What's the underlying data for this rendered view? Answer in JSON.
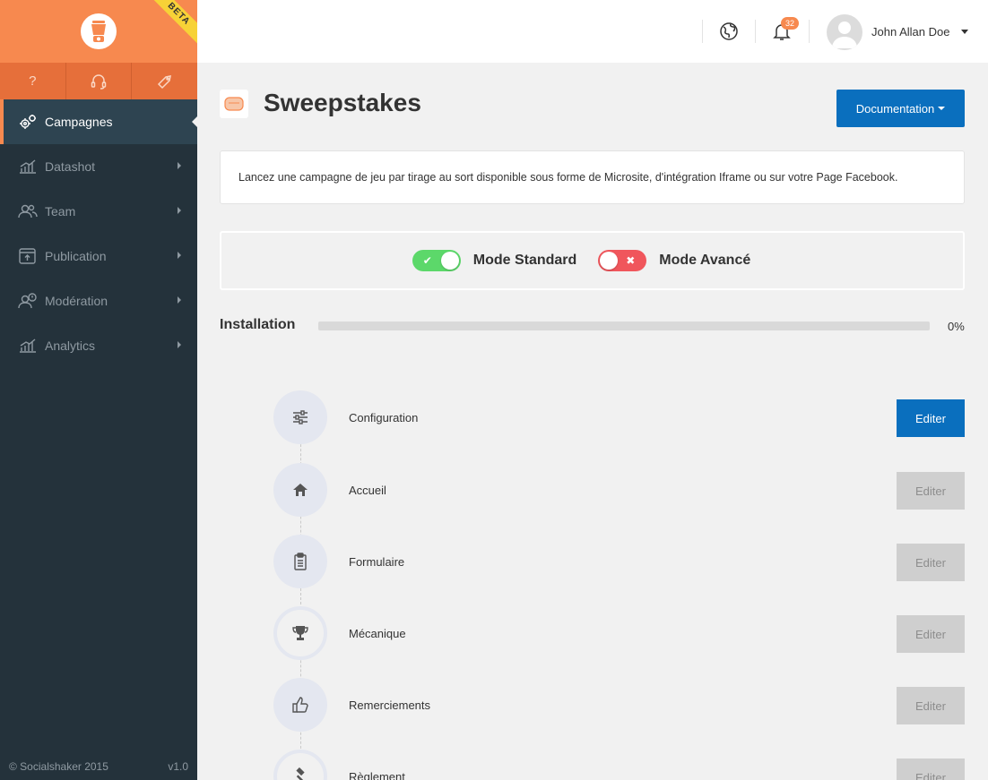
{
  "sidebar": {
    "beta_label": "BETA",
    "quick_buttons": [
      {
        "label": "?",
        "icon": "question-icon"
      },
      {
        "label": "",
        "icon": "headset-icon"
      },
      {
        "label": "",
        "icon": "tag-icon"
      }
    ],
    "items": [
      {
        "label": "Campagnes",
        "icon": "gears-icon",
        "active": true
      },
      {
        "label": "Datashot",
        "icon": "chart-icon"
      },
      {
        "label": "Team",
        "icon": "users-icon"
      },
      {
        "label": "Publication",
        "icon": "upload-icon"
      },
      {
        "label": "Modération",
        "icon": "moderation-icon"
      },
      {
        "label": "Analytics",
        "icon": "chart-icon"
      }
    ],
    "footer_copyright": "© Socialshaker 2015",
    "footer_version": "v1.0"
  },
  "header": {
    "notification_count": "32",
    "user_name": "John Allan Doe"
  },
  "page": {
    "title": "Sweepstakes",
    "doc_button": "Documentation",
    "description": "Lancez une campagne de jeu par tirage au sort disponible sous forme de Microsite, d'intégration Iframe ou sur votre Page Facebook.",
    "mode_standard": "Mode Standard",
    "mode_avance": "Mode Avancé",
    "install_label": "Installation",
    "progress_percent": 0,
    "progress_text": "0%"
  },
  "steps": [
    {
      "label": "Configuration",
      "button": "Editer",
      "enabled": true,
      "icon": "sliders-icon"
    },
    {
      "label": "Accueil",
      "button": "Editer",
      "enabled": false,
      "icon": "home-icon"
    },
    {
      "label": "Formulaire",
      "button": "Editer",
      "enabled": false,
      "icon": "clipboard-icon"
    },
    {
      "label": "Mécanique",
      "button": "Editer",
      "enabled": false,
      "icon": "trophy-icon"
    },
    {
      "label": "Remerciements",
      "button": "Editer",
      "enabled": false,
      "icon": "thumbs-up-icon"
    },
    {
      "label": "Règlement",
      "button": "Editer",
      "enabled": false,
      "icon": "gavel-icon"
    }
  ],
  "colors": {
    "sidebar": "#24323b",
    "brand": "#f7894f",
    "accent_blue": "#0a6fbe",
    "toggle_on": "#5cd86a",
    "toggle_off": "#f0565c"
  }
}
